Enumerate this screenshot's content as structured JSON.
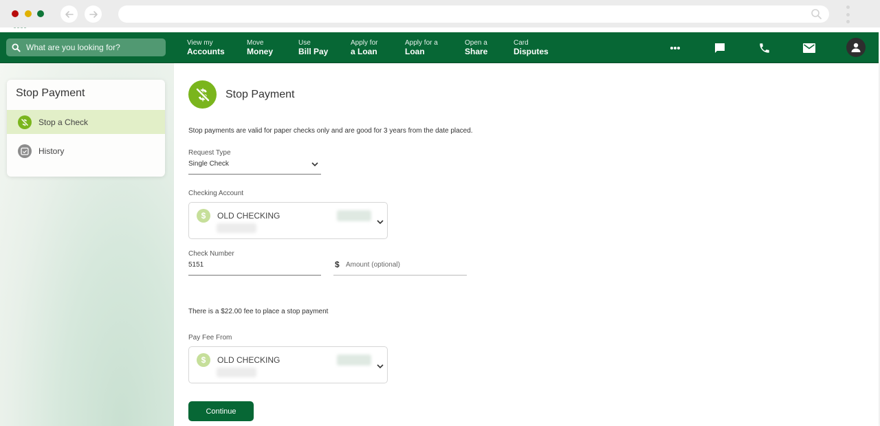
{
  "browser": {
    "back_icon": "arrow-left-icon",
    "forward_icon": "arrow-right-icon",
    "address_value": ""
  },
  "topnav": {
    "search_placeholder": "What are you looking for?",
    "items": [
      {
        "small": "View my",
        "big": "Accounts"
      },
      {
        "small": "Move",
        "big": "Money"
      },
      {
        "small": "Use",
        "big": "Bill Pay"
      },
      {
        "small": "Apply for",
        "big": "a Loan"
      },
      {
        "small": "Apply for a",
        "big": "Loan"
      },
      {
        "small": "Open a",
        "big": "Share"
      },
      {
        "small": "Card",
        "big": "Disputes"
      }
    ],
    "icons": [
      "more-icon",
      "chat-icon",
      "phone-icon",
      "mail-icon",
      "user-icon"
    ]
  },
  "sidebar": {
    "title": "Stop Payment",
    "items": [
      {
        "label": "Stop a Check",
        "icon": "no-dollar-icon",
        "active": true
      },
      {
        "label": "History",
        "icon": "calendar-check-icon",
        "active": false
      }
    ]
  },
  "main": {
    "title": "Stop Payment",
    "notice": "Stop payments are valid for paper checks only and are good for 3 years from the date placed.",
    "request_type": {
      "label": "Request Type",
      "value": "Single Check"
    },
    "checking_account": {
      "label": "Checking Account",
      "account_name": "OLD CHECKING"
    },
    "check_number": {
      "label": "Check Number",
      "value": "5151"
    },
    "amount": {
      "currency_symbol": "$",
      "placeholder": "Amount (optional)",
      "value": ""
    },
    "fee_notice": "There is a $22.00 fee to place a stop payment",
    "pay_fee_from": {
      "label": "Pay Fee From",
      "account_name": "OLD CHECKING"
    },
    "continue_label": "Continue"
  },
  "colors": {
    "brand_green": "#076735",
    "accent_lime": "#7ab51d",
    "active_row": "#e2efc8"
  }
}
